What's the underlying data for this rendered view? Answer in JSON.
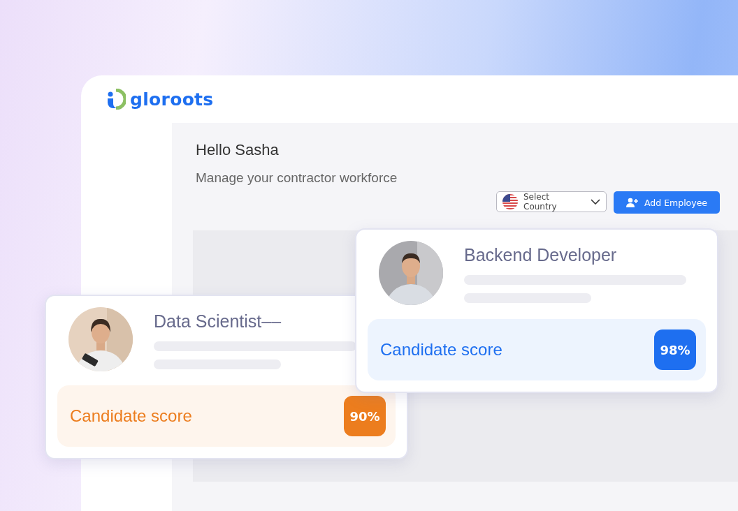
{
  "brand": {
    "name": "gloroots"
  },
  "greeting": {
    "title": "Hello Sasha",
    "subtitle": "Manage your contractor workforce"
  },
  "toolbar": {
    "country_select": {
      "placeholder": "Select Country"
    },
    "add_button": "Add Employee"
  },
  "candidates": [
    {
      "role": "Backend Developer",
      "score_label": "Candidate score",
      "score": "98%",
      "color": "#1e6ff0"
    },
    {
      "role": "Data Scientist––",
      "score_label": "Candidate score",
      "score": "90%",
      "color": "#ec7d1e"
    }
  ]
}
